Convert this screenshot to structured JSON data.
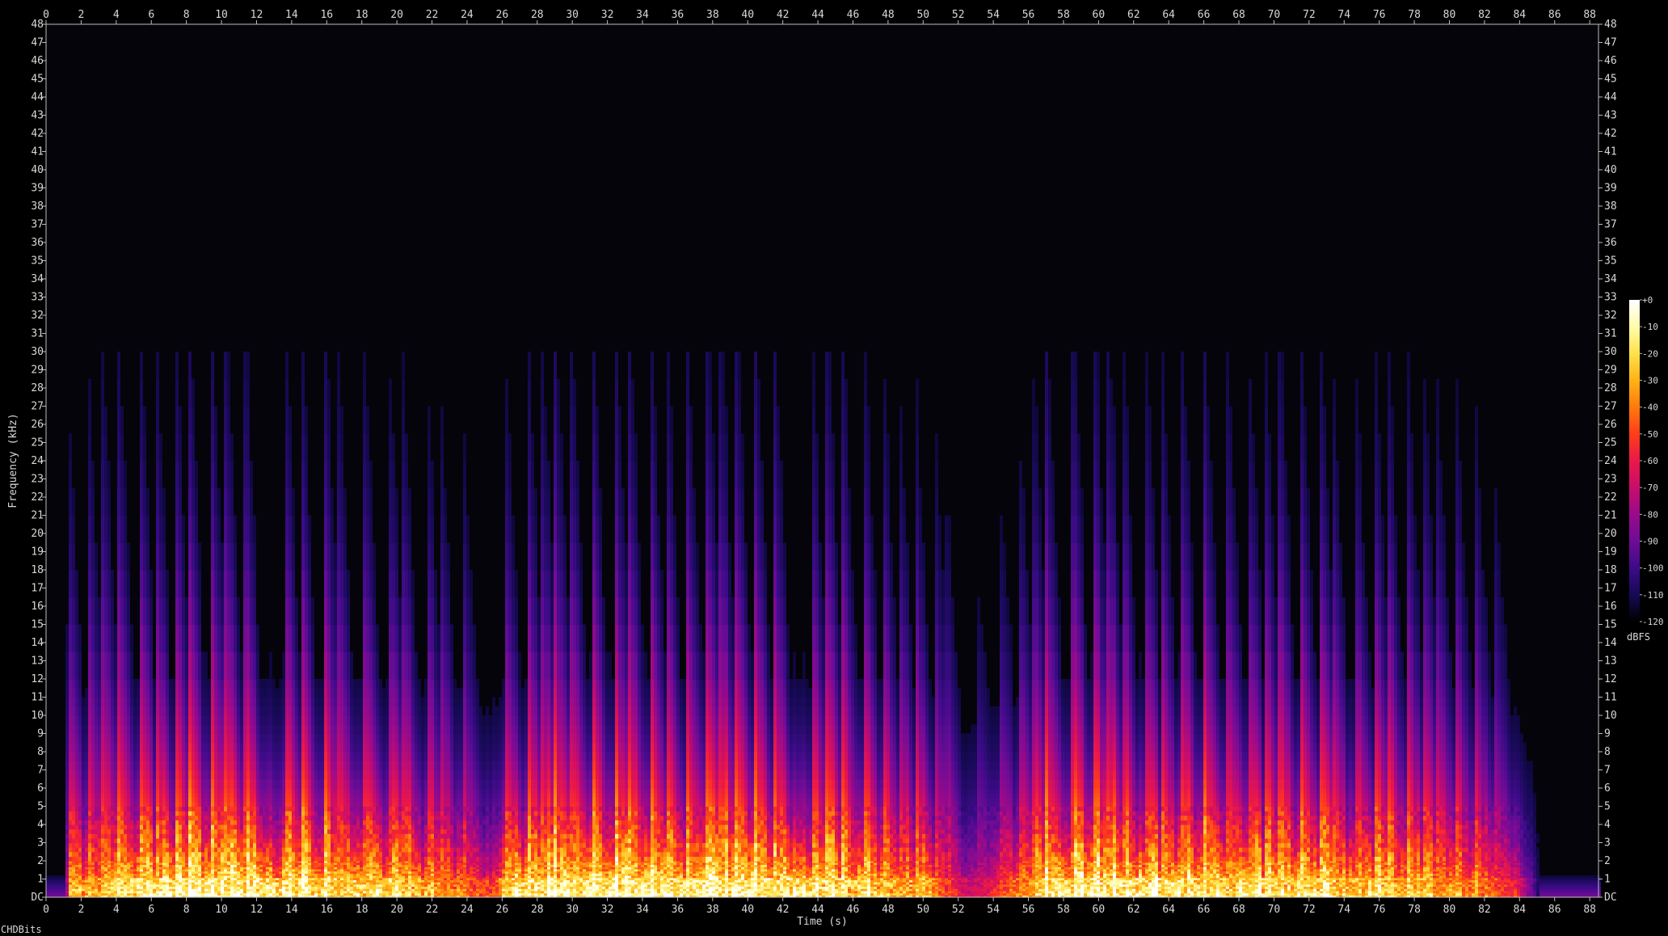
{
  "footer": {
    "label": "CHDBits"
  },
  "colors": {
    "background": "#000000",
    "plot_background": "#05040a",
    "axis": "#bdbdbd",
    "text": "#d8d8d8"
  },
  "chart_data": {
    "type": "heatmap",
    "title": "",
    "xlabel": "Time (s)",
    "ylabel": "Frequency (kHz)",
    "xlim": [
      0,
      88.5
    ],
    "ylim": [
      0,
      48
    ],
    "x_ticks": [
      0,
      2,
      4,
      6,
      8,
      10,
      12,
      14,
      16,
      18,
      20,
      22,
      24,
      26,
      28,
      30,
      32,
      34,
      36,
      38,
      40,
      42,
      44,
      46,
      48,
      50,
      52,
      54,
      56,
      58,
      60,
      62,
      64,
      66,
      68,
      70,
      72,
      74,
      76,
      78,
      80,
      82,
      84,
      86,
      88
    ],
    "y_ticks": [
      "DC",
      "1",
      "2",
      "3",
      "4",
      "5",
      "6",
      "7",
      "8",
      "9",
      "10",
      "11",
      "12",
      "13",
      "14",
      "15",
      "16",
      "17",
      "18",
      "19",
      "20",
      "21",
      "22",
      "23",
      "24",
      "25",
      "26",
      "27",
      "28",
      "29",
      "30",
      "31",
      "32",
      "33",
      "34",
      "35",
      "36",
      "37",
      "38",
      "39",
      "40",
      "41",
      "42",
      "43",
      "44",
      "45",
      "46",
      "47",
      "48"
    ],
    "colorbar": {
      "unit": "dBFS",
      "ticks": [
        "+0",
        "-10",
        "-20",
        "-30",
        "-40",
        "-50",
        "-60",
        "-70",
        "-80",
        "-90",
        "-100",
        "-110",
        "-120"
      ],
      "stops": [
        "#ffffff",
        "#fffcab",
        "#ffe14a",
        "#ffb315",
        "#ff7a0c",
        "#ff3d1a",
        "#eb1848",
        "#c80d6c",
        "#9a0a8a",
        "#6e0c96",
        "#3d0b88",
        "#160a55",
        "#000000"
      ]
    },
    "silence_intervals_s": [
      [
        0,
        1
      ],
      [
        85,
        88.5
      ]
    ],
    "attack_times_s": [
      1.1,
      2.3,
      3.1,
      4.0,
      5.2,
      6.1,
      7.2,
      8.0,
      9.3,
      10.1,
      11.2,
      13.5,
      14.4,
      15.8,
      16.5,
      18.0,
      19.4,
      20.2,
      21.6,
      22.4,
      23.7,
      26.0,
      27.3,
      28.1,
      28.9,
      29.8,
      31.0,
      32.3,
      33.1,
      34.3,
      35.2,
      36.4,
      37.5,
      38.3,
      39.2,
      40.3,
      41.4,
      43.5,
      44.4,
      45.3,
      46.5,
      47.6,
      48.5,
      49.4,
      50.6,
      51.2,
      52.9,
      54.2,
      55.3,
      56.1,
      56.9,
      58.4,
      59.6,
      60.4,
      61.2,
      62.5,
      63.4,
      64.6,
      65.9,
      67.2,
      68.4,
      69.3,
      70.2,
      71.4,
      72.5,
      73.2,
      74.5,
      75.6,
      76.4,
      77.5,
      78.4,
      79.2,
      80.3,
      81.4,
      82.5
    ],
    "energy_envelope": [
      {
        "t": 0,
        "level": 0
      },
      {
        "t": 1,
        "level": 0.05
      },
      {
        "t": 1.2,
        "level": 0.75
      },
      {
        "t": 6,
        "level": 0.95
      },
      {
        "t": 14,
        "level": 0.9
      },
      {
        "t": 20,
        "level": 0.85
      },
      {
        "t": 25.5,
        "level": 0.6
      },
      {
        "t": 26.2,
        "level": 0.88
      },
      {
        "t": 30,
        "level": 0.95
      },
      {
        "t": 36,
        "level": 0.95
      },
      {
        "t": 44,
        "level": 0.9
      },
      {
        "t": 50,
        "level": 0.78
      },
      {
        "t": 52.5,
        "level": 0.45
      },
      {
        "t": 54,
        "level": 0.55
      },
      {
        "t": 57,
        "level": 0.92
      },
      {
        "t": 62,
        "level": 0.95
      },
      {
        "t": 66,
        "level": 0.9
      },
      {
        "t": 72,
        "level": 0.88
      },
      {
        "t": 78,
        "level": 0.8
      },
      {
        "t": 82,
        "level": 0.68
      },
      {
        "t": 84,
        "level": 0.5
      },
      {
        "t": 85,
        "level": 0.1
      },
      {
        "t": 88.5,
        "level": 0.08
      }
    ]
  }
}
